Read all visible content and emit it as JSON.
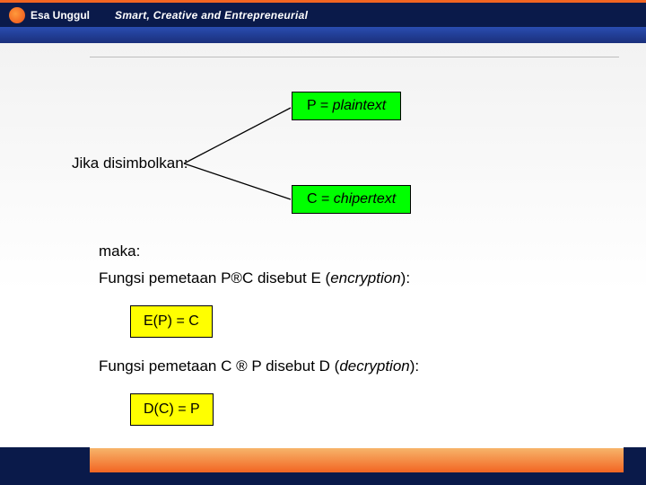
{
  "header": {
    "brand": "Esa Unggul",
    "tagline": "Smart, Creative and Entrepreneurial"
  },
  "labels": {
    "jika": "Jika disimbolkan:",
    "maka": "maka:"
  },
  "boxes": {
    "plaintext_prefix": "P = ",
    "plaintext_em": "plaintext",
    "chipertext_prefix": "C = ",
    "chipertext_em": "chipertext",
    "ep": "E(P) = C",
    "dc": "D(C) = P"
  },
  "lines": {
    "encryption_pre": "Fungsi pemetaan P",
    "encryption_mid": "C disebut E (",
    "encryption_em": "encryption",
    "encryption_post": "):",
    "decryption_pre": "Fungsi pemetaan C ",
    "decryption_mid": " P disebut D (",
    "decryption_em": "decryption",
    "decryption_post": "):"
  },
  "glyphs": {
    "arrow": "®"
  }
}
